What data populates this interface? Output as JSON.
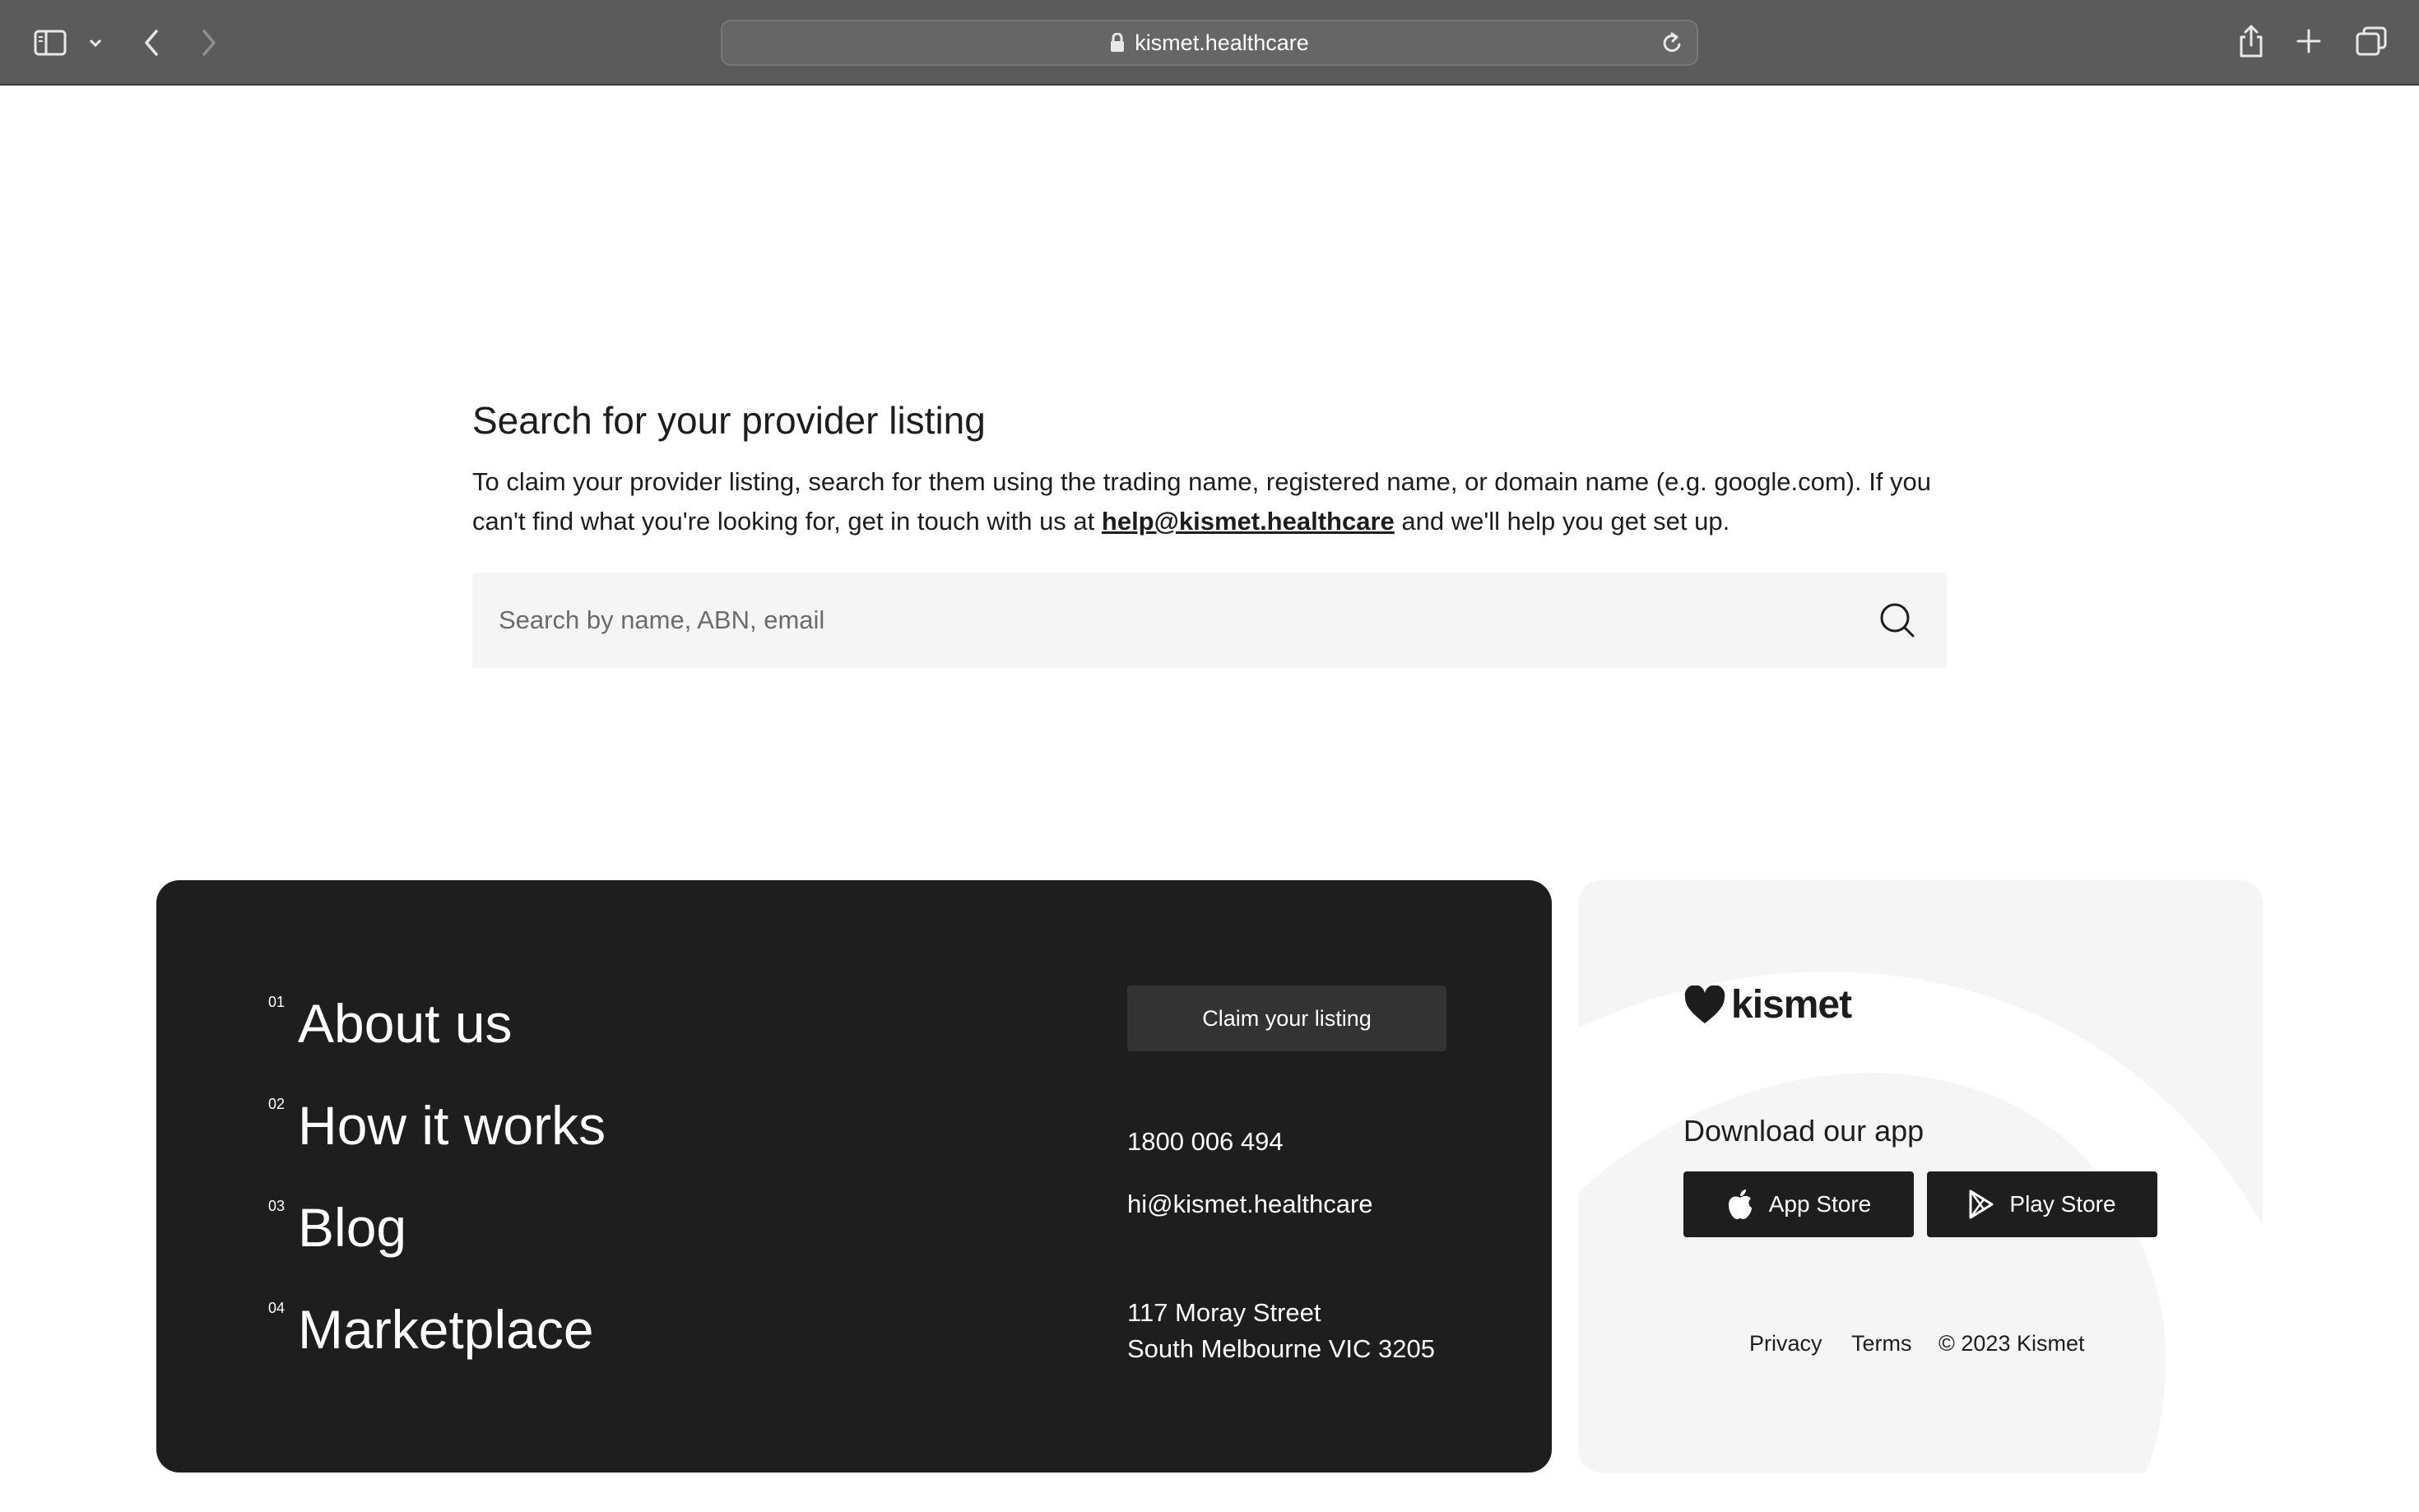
{
  "browser": {
    "url": "kismet.healthcare"
  },
  "main": {
    "heading": "Search for your provider listing",
    "description_before": "To claim your provider listing, search for them using the trading name, registered name, or domain name (e.g. google.com). If you can't find what you're looking for, get in touch with us at ",
    "description_email": "help@kismet.healthcare",
    "description_after": " and we'll help you get set up.",
    "search": {
      "placeholder": "Search by name, ABN, email",
      "value": ""
    }
  },
  "footer": {
    "nav": [
      {
        "num": "01",
        "label": "About us"
      },
      {
        "num": "02",
        "label": "How it works"
      },
      {
        "num": "03",
        "label": "Blog"
      },
      {
        "num": "04",
        "label": "Marketplace"
      }
    ],
    "claim_button": "Claim your listing",
    "phone": "1800 006 494",
    "email": "hi@kismet.healthcare",
    "address_line1": "117 Moray Street",
    "address_line2": "South Melbourne VIC 3205",
    "brand": "kismet",
    "download_title": "Download our app",
    "app_store": "App Store",
    "play_store": "Play Store",
    "privacy": "Privacy",
    "terms": "Terms",
    "copyright": "© 2023 Kismet"
  },
  "colors": {
    "toolbar": "#5b5b5b",
    "footer_dark": "#1e1e1e",
    "footer_light": "#f5f5f5",
    "search_bg": "#f5f5f5"
  }
}
